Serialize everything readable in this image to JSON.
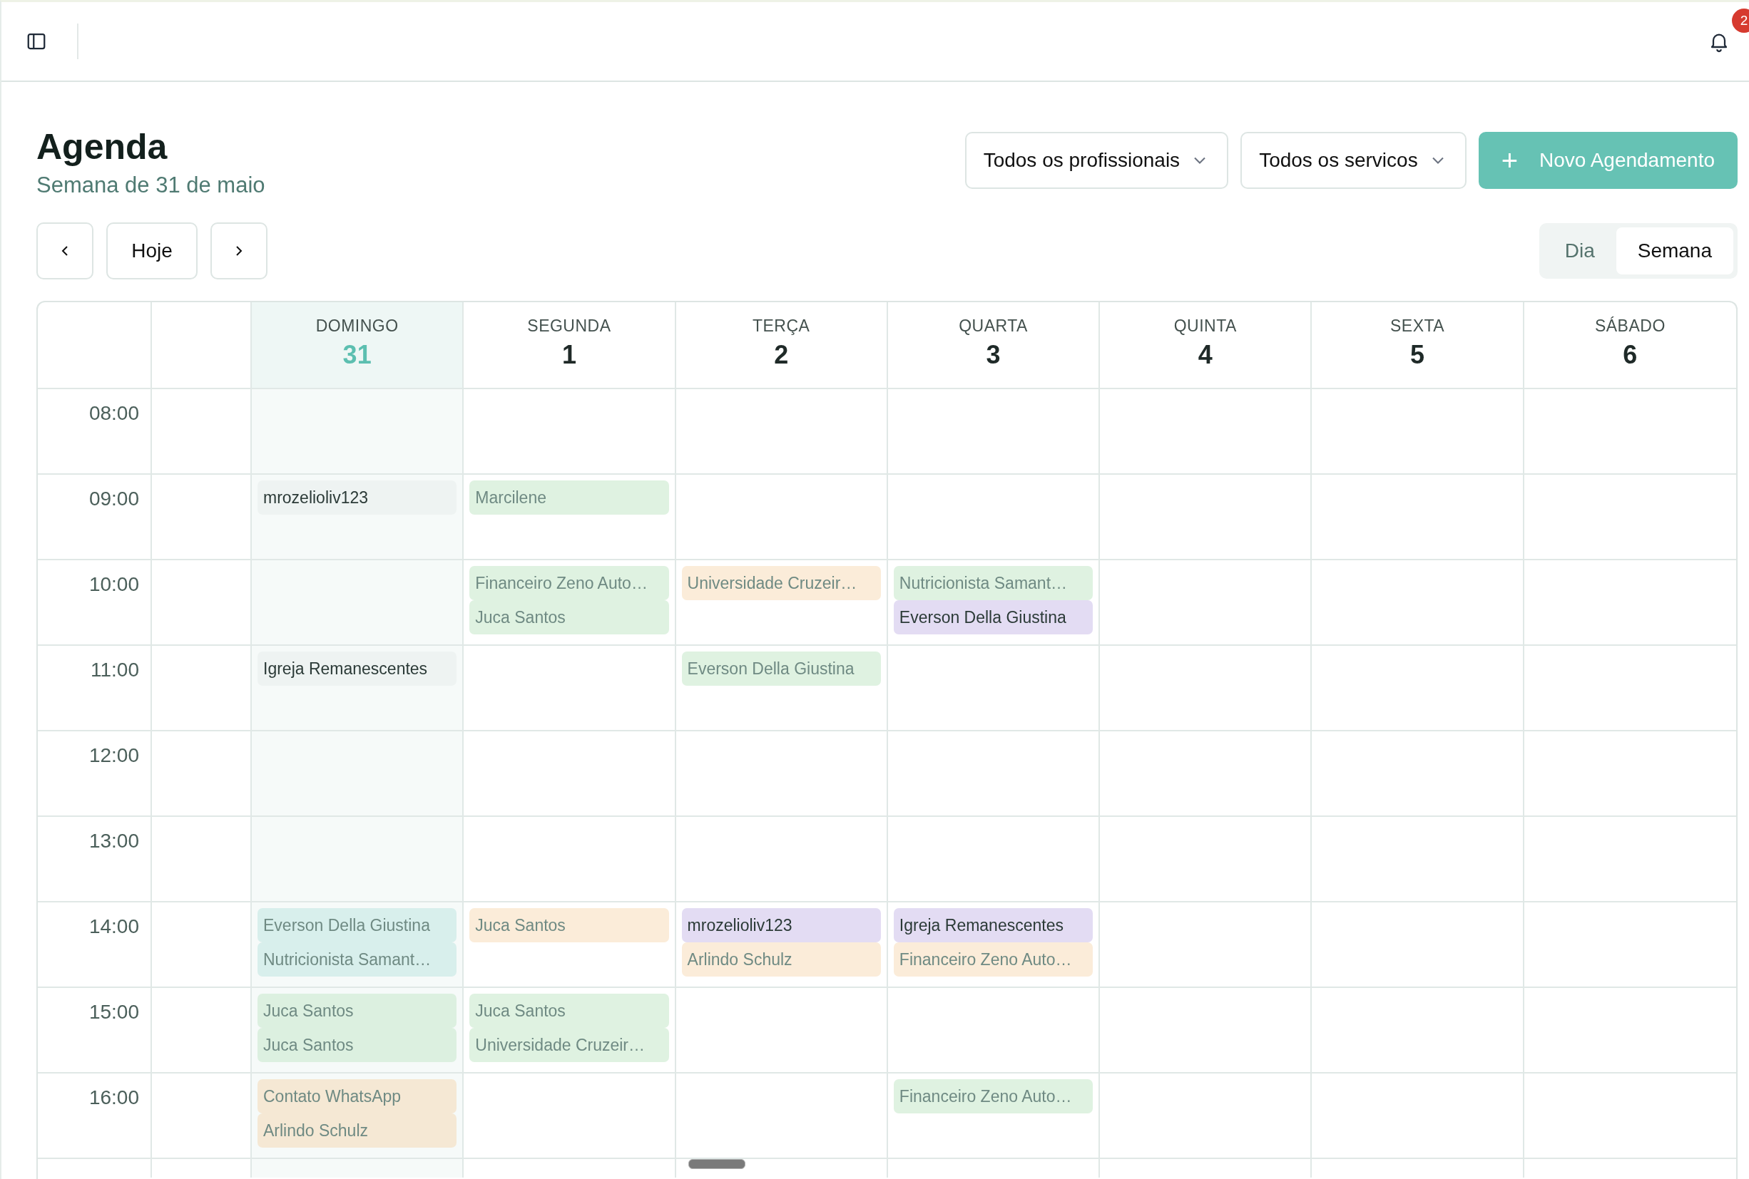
{
  "topbar": {
    "notification_count": "2"
  },
  "header": {
    "title": "Agenda",
    "subtitle": "Semana de 31 de maio"
  },
  "filters": [
    {
      "label": "Todos os profissionais"
    },
    {
      "label": "Todos os servicos"
    }
  ],
  "primary_button": {
    "icon": "+",
    "label": "Novo Agendamento"
  },
  "nav": {
    "today": "Hoje"
  },
  "view_toggle": [
    {
      "label": "Dia",
      "selected": false
    },
    {
      "label": "Semana",
      "selected": true
    }
  ],
  "days": [
    {
      "name": "DOMINGO",
      "number": "31",
      "selected": true
    },
    {
      "name": "SEGUNDA",
      "number": "1",
      "selected": false
    },
    {
      "name": "TERÇA",
      "number": "2",
      "selected": false
    },
    {
      "name": "QUARTA",
      "number": "3",
      "selected": false
    },
    {
      "name": "QUINTA",
      "number": "4",
      "selected": false
    },
    {
      "name": "SEXTA",
      "number": "5",
      "selected": false
    },
    {
      "name": "SÁBADO",
      "number": "6",
      "selected": false
    }
  ],
  "rows": [
    {
      "time": "08:00",
      "cells": [
        [],
        [],
        [],
        [],
        [],
        [],
        []
      ]
    },
    {
      "time": "09:00",
      "cells": [
        [
          {
            "title": "mrozelioliv123",
            "color": "#eef3f2",
            "muted": false
          }
        ],
        [
          {
            "title": "Marcilene",
            "color": "#dff2e1",
            "muted": true
          }
        ],
        [],
        [],
        [],
        [],
        []
      ]
    },
    {
      "time": "10:00",
      "cells": [
        [],
        [
          {
            "title": "Financeiro Zeno Auto…",
            "color": "#dff2e1",
            "muted": true
          },
          {
            "title": "Juca Santos",
            "color": "#dff2e1",
            "muted": true
          }
        ],
        [
          {
            "title": "Universidade Cruzeir…",
            "color": "#fbecd9",
            "muted": true
          }
        ],
        [
          {
            "title": "Nutricionista Samant…",
            "color": "#dff2e1",
            "muted": true
          },
          {
            "title": "Everson Della Giustina",
            "color": "#e3dcf3",
            "muted": false
          }
        ],
        [],
        [],
        []
      ]
    },
    {
      "time": "11:00",
      "cells": [
        [
          {
            "title": "Igreja Remanescentes",
            "color": "#eef3f2",
            "muted": false
          }
        ],
        [],
        [
          {
            "title": "Everson Della Giustina",
            "color": "#dff2e1",
            "muted": true
          }
        ],
        [],
        [],
        [],
        []
      ]
    },
    {
      "time": "12:00",
      "cells": [
        [],
        [],
        [],
        [],
        [],
        [],
        []
      ]
    },
    {
      "time": "13:00",
      "cells": [
        [],
        [],
        [],
        [],
        [],
        [],
        []
      ]
    },
    {
      "time": "14:00",
      "cells": [
        [
          {
            "title": "Everson Della Giustina",
            "color": "#d8efec",
            "muted": true
          },
          {
            "title": "Nutricionista Samant…",
            "color": "#d8efec",
            "muted": true
          }
        ],
        [
          {
            "title": "Juca Santos",
            "color": "#fbecd9",
            "muted": true
          }
        ],
        [
          {
            "title": "mrozelioliv123",
            "color": "#e3dcf3",
            "muted": false
          },
          {
            "title": "Arlindo Schulz",
            "color": "#fbecd9",
            "muted": true
          }
        ],
        [
          {
            "title": "Igreja Remanescentes",
            "color": "#e3dcf3",
            "muted": false
          },
          {
            "title": "Financeiro Zeno Auto…",
            "color": "#fbecd9",
            "muted": true
          }
        ],
        [],
        [],
        []
      ]
    },
    {
      "time": "15:00",
      "cells": [
        [
          {
            "title": "Juca Santos",
            "color": "#dcf0e0",
            "muted": true
          },
          {
            "title": "Juca Santos",
            "color": "#dcf0e0",
            "muted": true
          }
        ],
        [
          {
            "title": "Juca Santos",
            "color": "#dff2e1",
            "muted": true
          },
          {
            "title": "Universidade Cruzeir…",
            "color": "#dff2e1",
            "muted": true
          }
        ],
        [],
        [],
        [],
        [],
        []
      ]
    },
    {
      "time": "16:00",
      "cells": [
        [
          {
            "title": "Contato WhatsApp",
            "color": "#f5e8d4",
            "muted": true
          },
          {
            "title": "Arlindo Schulz",
            "color": "#f5e8d4",
            "muted": true
          }
        ],
        [],
        [],
        [
          {
            "title": "Financeiro Zeno Auto…",
            "color": "#dff2e1",
            "muted": true
          }
        ],
        [],
        [],
        []
      ]
    }
  ]
}
